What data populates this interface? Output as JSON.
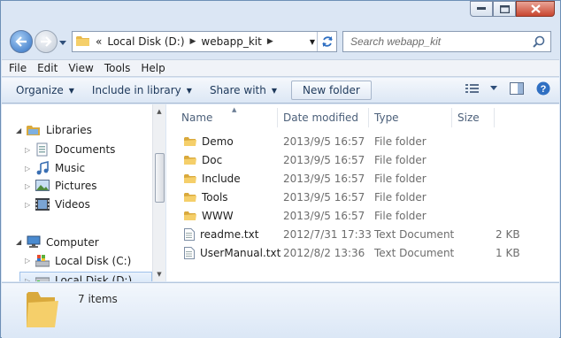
{
  "address": {
    "overflow_chevron": "«",
    "crumbs": [
      "Local Disk (D:)",
      "webapp_kit"
    ]
  },
  "search": {
    "placeholder": "Search webapp_kit"
  },
  "menu": [
    "File",
    "Edit",
    "View",
    "Tools",
    "Help"
  ],
  "toolbar": {
    "organize": "Organize",
    "include_in_library": "Include in library",
    "share_with": "Share with",
    "new_folder": "New folder"
  },
  "nav": {
    "libraries": "Libraries",
    "documents": "Documents",
    "music": "Music",
    "pictures": "Pictures",
    "videos": "Videos",
    "computer": "Computer",
    "drive_c": "Local Disk (C:)",
    "drive_d": "Local Disk (D:)"
  },
  "columns": {
    "name": "Name",
    "date_modified": "Date modified",
    "type": "Type",
    "size": "Size"
  },
  "files": [
    {
      "name": "Demo",
      "date": "2013/9/5 16:57",
      "type": "File folder",
      "size": "",
      "icon": "folder-icon"
    },
    {
      "name": "Doc",
      "date": "2013/9/5 16:57",
      "type": "File folder",
      "size": "",
      "icon": "folder-icon"
    },
    {
      "name": "Include",
      "date": "2013/9/5 16:57",
      "type": "File folder",
      "size": "",
      "icon": "folder-icon"
    },
    {
      "name": "Tools",
      "date": "2013/9/5 16:57",
      "type": "File folder",
      "size": "",
      "icon": "folder-icon"
    },
    {
      "name": "WWW",
      "date": "2013/9/5 16:57",
      "type": "File folder",
      "size": "",
      "icon": "folder-icon"
    },
    {
      "name": "readme.txt",
      "date": "2012/7/31 17:33",
      "type": "Text Document",
      "size": "2 KB",
      "icon": "text-file-icon"
    },
    {
      "name": "UserManual.txt",
      "date": "2012/8/2 13:36",
      "type": "Text Document",
      "size": "1 KB",
      "icon": "text-file-icon"
    }
  ],
  "details": {
    "item_count": "7 items"
  }
}
